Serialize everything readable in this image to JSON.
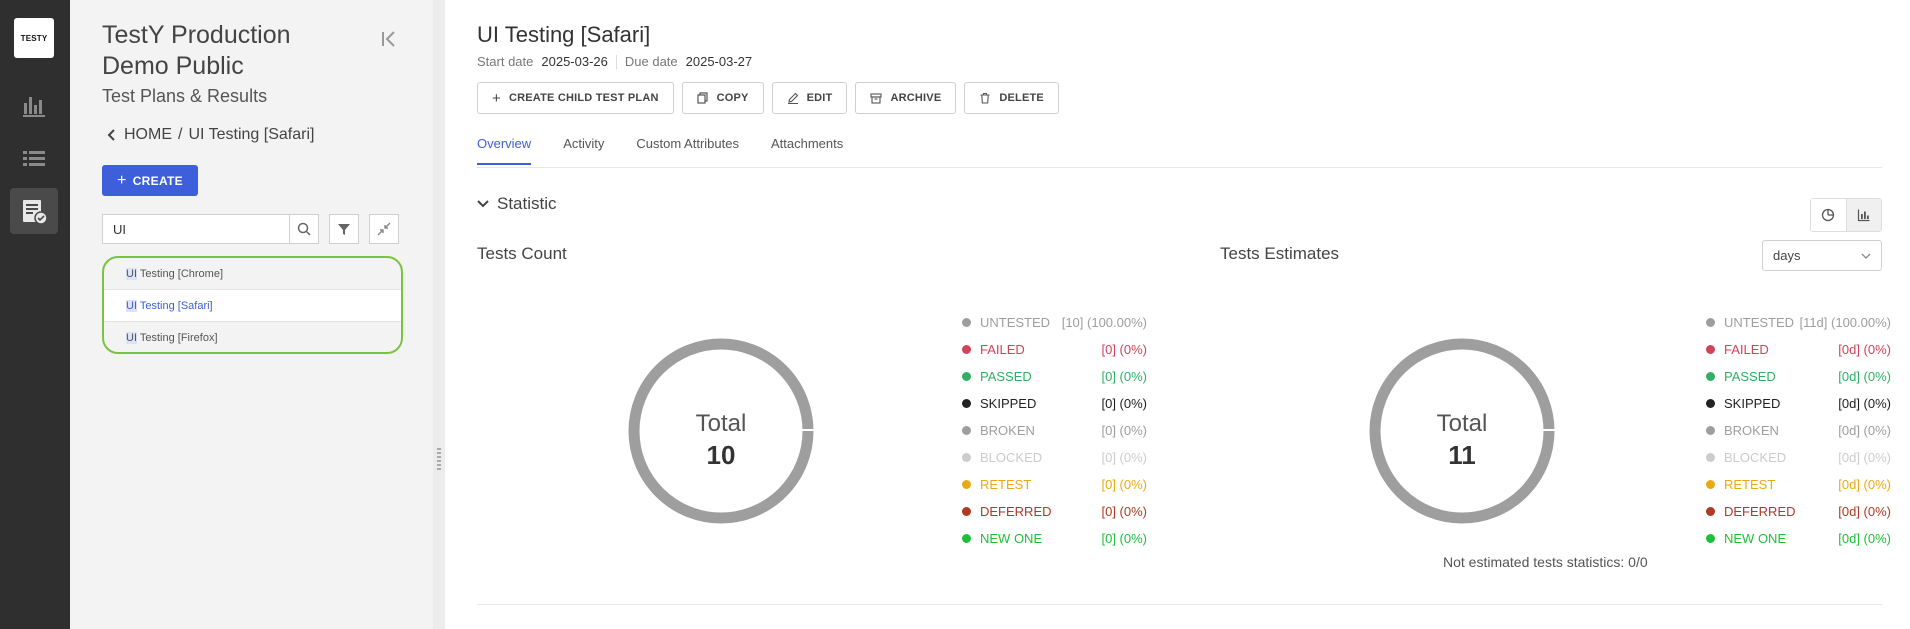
{
  "rail": {
    "logo": "TESTY"
  },
  "sidebar": {
    "title": "TestY Production Demo Public",
    "subtitle": "Test Plans & Results",
    "breadcrumb": {
      "home": "HOME",
      "sep": "/",
      "current": "UI Testing [Safari]"
    },
    "create_label": "CREATE",
    "search_value": "UI",
    "items": [
      {
        "match": "UI",
        "rest": " Testing [Chrome]"
      },
      {
        "match": "UI",
        "rest": " Testing [Safari]"
      },
      {
        "match": "UI",
        "rest": " Testing [Firefox]"
      }
    ]
  },
  "main": {
    "title": "UI Testing [Safari]",
    "start_label": "Start date",
    "start_date": "2025-03-26",
    "due_label": "Due date",
    "due_date": "2025-03-27",
    "actions": {
      "create_child": "CREATE CHILD TEST PLAN",
      "copy": "COPY",
      "edit": "EDIT",
      "archive": "ARCHIVE",
      "delete": "DELETE"
    },
    "tabs": [
      "Overview",
      "Activity",
      "Custom Attributes",
      "Attachments"
    ],
    "statistic_label": "Statistic",
    "tests_count": {
      "title": "Tests Count",
      "total_label": "Total",
      "total_value": "10",
      "legend": [
        {
          "label": "UNTESTED",
          "value": "[10] (100.00%)",
          "color": "#9e9e9e"
        },
        {
          "label": "FAILED",
          "value": "[0] (0%)",
          "color": "#d0435a"
        },
        {
          "label": "PASSED",
          "value": "[0] (0%)",
          "color": "#2fae64"
        },
        {
          "label": "SKIPPED",
          "value": "[0] (0%)",
          "color": "#222222"
        },
        {
          "label": "BROKEN",
          "value": "[0] (0%)",
          "color": "#9e9e9e"
        },
        {
          "label": "BLOCKED",
          "value": "[0] (0%)",
          "color": "#cccccc"
        },
        {
          "label": "RETEST",
          "value": "[0] (0%)",
          "color": "#e9a915"
        },
        {
          "label": "DEFERRED",
          "value": "[0] (0%)",
          "color": "#b0391f"
        },
        {
          "label": "NEW ONE",
          "value": "[0] (0%)",
          "color": "#1fbf3a"
        }
      ]
    },
    "tests_estimates": {
      "title": "Tests Estimates",
      "unit_select": "days",
      "total_label": "Total",
      "total_value": "11",
      "legend": [
        {
          "label": "UNTESTED",
          "value": "[11d] (100.00%)",
          "color": "#9e9e9e"
        },
        {
          "label": "FAILED",
          "value": "[0d] (0%)",
          "color": "#d0435a"
        },
        {
          "label": "PASSED",
          "value": "[0d] (0%)",
          "color": "#2fae64"
        },
        {
          "label": "SKIPPED",
          "value": "[0d] (0%)",
          "color": "#222222"
        },
        {
          "label": "BROKEN",
          "value": "[0d] (0%)",
          "color": "#9e9e9e"
        },
        {
          "label": "BLOCKED",
          "value": "[0d] (0%)",
          "color": "#cccccc"
        },
        {
          "label": "RETEST",
          "value": "[0d] (0%)",
          "color": "#e9a915"
        },
        {
          "label": "DEFERRED",
          "value": "[0d] (0%)",
          "color": "#b0391f"
        },
        {
          "label": "NEW ONE",
          "value": "[0d] (0%)",
          "color": "#1fbf3a"
        }
      ],
      "note": "Not estimated tests statistics: 0/0"
    }
  }
}
